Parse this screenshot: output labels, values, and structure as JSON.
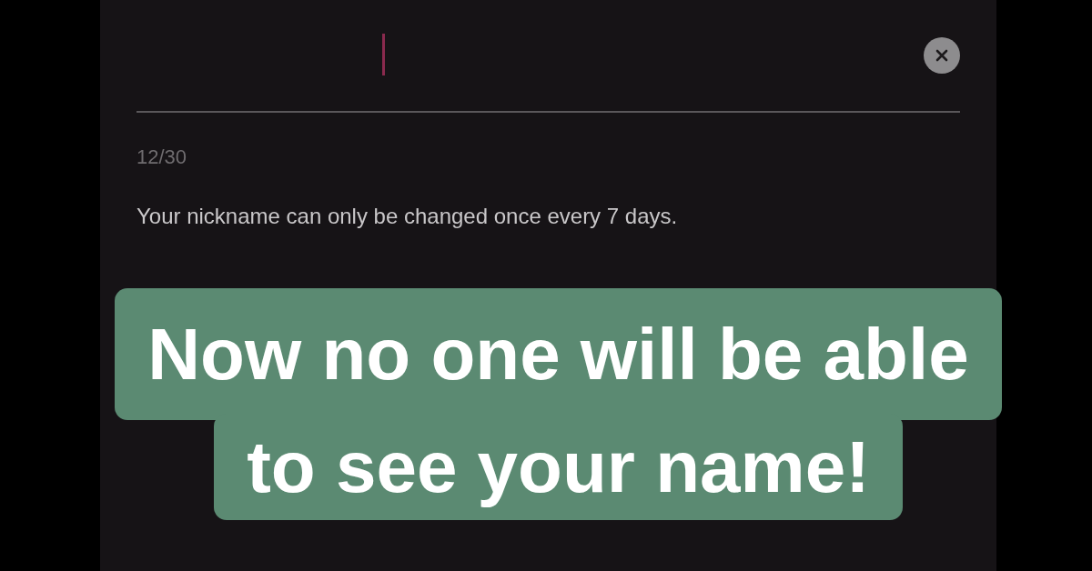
{
  "nickname_field": {
    "counter": "12/30",
    "note": "Your nickname can only be changed once every 7 days."
  },
  "caption": {
    "lines": [
      "Now no one will be able",
      "to see your name!"
    ]
  }
}
